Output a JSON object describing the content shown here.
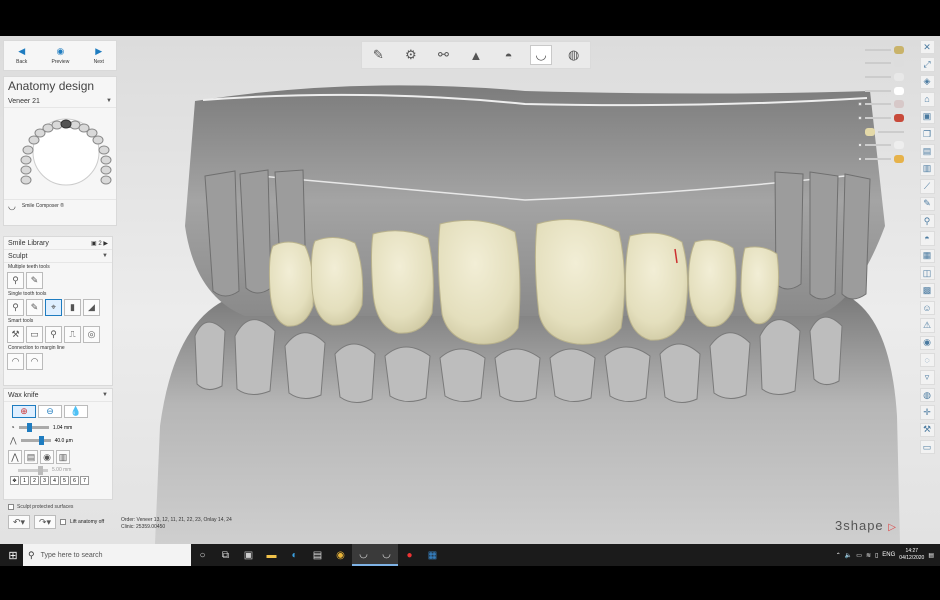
{
  "nav": {
    "back": "Back",
    "preview": "Preview",
    "next": "Next"
  },
  "panel": {
    "title": "Anatomy design",
    "tooth_selector": "Veneer 21",
    "smile_composer": "Smile Composer ®",
    "smile_library": "Smile Library",
    "smile_library_count": "2",
    "sculpt": "Sculpt",
    "multiple_tools": "Multiple teeth tools",
    "single_tools": "Single tooth tools",
    "smart_tools": "Smart tools",
    "connection_margin": "Connection to margin line",
    "wax_knife": "Wax knife",
    "wax_size": "1.04 mm",
    "wax_strength": "40.0 µm",
    "wax_depth": "5.00 mm",
    "numbers": [
      "1",
      "2",
      "3",
      "4",
      "5",
      "6",
      "7"
    ],
    "sculpt_protected": "Sculpt protected surfaces",
    "lift_anatomy": "Lift anatomy off"
  },
  "order": {
    "line1": "Order:  Veneer 13, 12, 11, 21, 22, 23, Onlay 14, 24",
    "line2": "Clinic:  25359.00450"
  },
  "brand": "3shape",
  "taskbar": {
    "search_placeholder": "Type here to search",
    "lang": "ENG",
    "time": "14:27",
    "date": "04/12/2020"
  },
  "colors": {
    "accent": "#1e7cc0",
    "tooth": "#e9e4c4",
    "gum": "#9a9a9a"
  }
}
